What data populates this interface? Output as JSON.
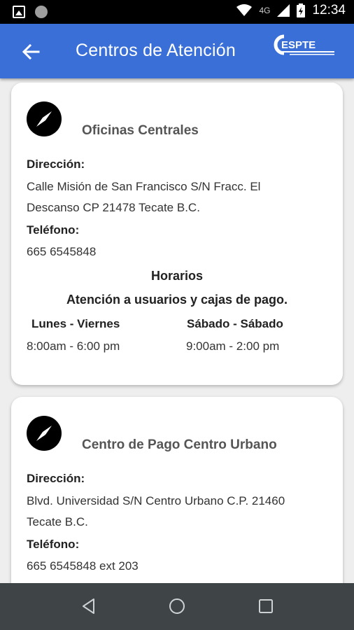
{
  "status_bar": {
    "network": "4G",
    "time": "12:34"
  },
  "app_bar": {
    "title": "Centros de Atención",
    "logo_text": "ESPTE",
    "back_icon": "arrow-back-icon"
  },
  "colors": {
    "app_bar": "#3a6fd8",
    "status_bar": "#000000",
    "nav_bar": "#3f4446",
    "card": "#ffffff",
    "background": "#eeeeee"
  },
  "cards": [
    {
      "icon": "compass-icon",
      "title": "Oficinas Centrales",
      "address_label": "Dirección:",
      "address_line1": "Calle Misión de San Francisco S/N Fracc. El",
      "address_line2": "Descanso CP 21478 Tecate B.C.",
      "phone_label": "Teléfono:",
      "phone": "665 6545848",
      "hours_title": "Horarios",
      "hours_subtitle": "Atención a usuarios y cajas de pago.",
      "weekday_label": "Lunes - Viernes",
      "weekday_hours": "8:00am - 6:00 pm",
      "weekend_label": "Sábado - Sábado",
      "weekend_hours": "9:00am - 2:00 pm"
    },
    {
      "icon": "compass-icon",
      "title": "Centro de Pago Centro Urbano",
      "address_label": "Dirección:",
      "address_line1": "Blvd. Universidad S/N Centro Urbano C.P. 21460",
      "address_line2": "Tecate B.C.",
      "phone_label": "Teléfono:",
      "phone": "665 6545848 ext 203"
    }
  ],
  "nav_bar": {
    "back": "nav-back-icon",
    "home": "nav-home-icon",
    "recents": "nav-recents-icon"
  }
}
